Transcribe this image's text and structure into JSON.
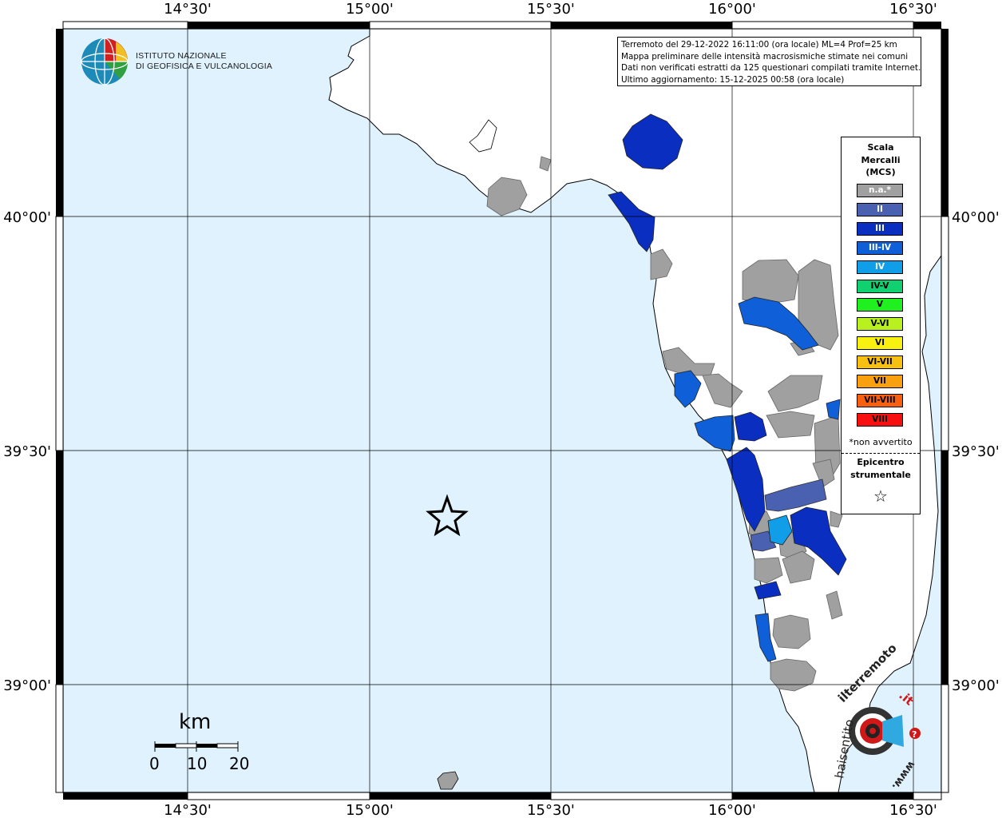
{
  "map": {
    "top_lon_labels": [
      "14°30'",
      "15°00'",
      "15°30'",
      "16°00'",
      "16°30'"
    ],
    "bottom_lon_labels": [
      "14°30'",
      "15°00'",
      "15°30'",
      "16°00'",
      "16°30'"
    ],
    "left_lat_labels": [
      "40°00'",
      "39°30'",
      "39°00'"
    ],
    "right_lat_labels": [
      "40°00'",
      "39°30'",
      "39°00'"
    ],
    "sea_color": "#dff2fd",
    "land_color": "#ffffff"
  },
  "logo_ingv": {
    "line1": "ISTITUTO NAZIONALE",
    "line2": "DI GEOFISICA E VULCANOLOGIA",
    "icon": "globe-icon"
  },
  "info": {
    "line1": "Terremoto del 29-12-2022 16:11:00 (ora locale) ML=4 Prof=25 km",
    "line2": "Mappa preliminare delle intensità macrosismiche stimate nei comuni",
    "line3": "Dati non verificati estratti da 125 questionari compilati tramite Internet.",
    "line4": "Ultimo aggiornamento: 15-12-2025 00:58 (ora locale)"
  },
  "legend": {
    "title1": "Scala",
    "title2": "Mercalli",
    "title3": "(MCS)",
    "items": [
      {
        "label": "n.a.*",
        "color": "#a0a0a0",
        "text": "#ffffff"
      },
      {
        "label": "II",
        "color": "#4a60b0",
        "text": "#ffffff"
      },
      {
        "label": "III",
        "color": "#0a2fc0",
        "text": "#ffffff"
      },
      {
        "label": "III-IV",
        "color": "#0f5fd8",
        "text": "#ffffff"
      },
      {
        "label": "IV",
        "color": "#109ee8",
        "text": "#ffffff"
      },
      {
        "label": "IV-V",
        "color": "#10d070",
        "text": "#000000"
      },
      {
        "label": "V",
        "color": "#20f020",
        "text": "#000000"
      },
      {
        "label": "V-VI",
        "color": "#b8f020",
        "text": "#000000"
      },
      {
        "label": "VI",
        "color": "#f8f010",
        "text": "#000000"
      },
      {
        "label": "VI-VII",
        "color": "#f8c010",
        "text": "#000000"
      },
      {
        "label": "VII",
        "color": "#f8a010",
        "text": "#000000"
      },
      {
        "label": "VII-VIII",
        "color": "#f86010",
        "text": "#000000"
      },
      {
        "label": "VIII",
        "color": "#f81010",
        "text": "#000000"
      }
    ],
    "note": "*non avvertito",
    "epicenter_line1": "Epicentro",
    "epicenter_line2": "strumentale",
    "star_icon": "star-icon",
    "star_glyph": "☆"
  },
  "scale_bar": {
    "unit": "km",
    "labels": [
      "0",
      "10",
      "20"
    ]
  },
  "epicenter": {
    "icon": "star-icon"
  },
  "logo_hsit": {
    "text_a": "haisentito",
    "text_b": "ilterremoto",
    "text_c": ".it",
    "text_d": "www.",
    "question": "?"
  }
}
